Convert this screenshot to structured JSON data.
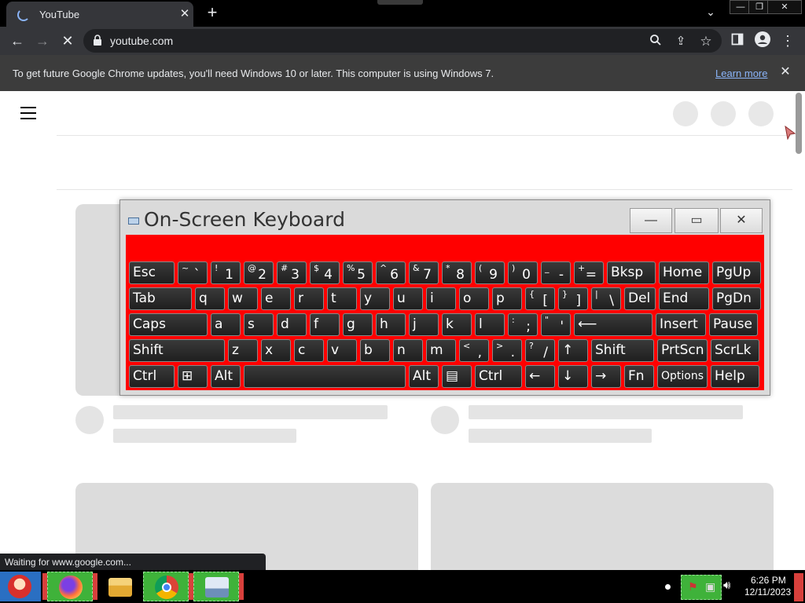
{
  "browser": {
    "tab_title": "YouTube",
    "tab_close_glyph": "✕",
    "new_tab_glyph": "+",
    "url": "youtube.com",
    "window_controls": {
      "minimize": "—",
      "maximize": "❐",
      "close": "✕"
    }
  },
  "infobar": {
    "message": "To get future Google Chrome updates, you'll need Windows 10 or later. This computer is using Windows 7.",
    "link": "Learn more",
    "close_glyph": "✕"
  },
  "osk": {
    "title": "On-Screen Keyboard",
    "controls": {
      "minimize": "—",
      "maximize": "▭",
      "close": "✕"
    },
    "accent_color": "#ff0000",
    "rows": [
      [
        {
          "label": "Esc"
        },
        {
          "top": "~",
          "bottom": "`"
        },
        {
          "top": "!",
          "bottom": "1"
        },
        {
          "top": "@",
          "bottom": "2"
        },
        {
          "top": "#",
          "bottom": "3"
        },
        {
          "top": "$",
          "bottom": "4"
        },
        {
          "top": "%",
          "bottom": "5"
        },
        {
          "top": "^",
          "bottom": "6"
        },
        {
          "top": "&",
          "bottom": "7"
        },
        {
          "top": "*",
          "bottom": "8"
        },
        {
          "top": "(",
          "bottom": "9"
        },
        {
          "top": ")",
          "bottom": "0"
        },
        {
          "top": "_",
          "bottom": "-"
        },
        {
          "top": "+",
          "bottom": "="
        },
        {
          "label": "Bksp"
        },
        {
          "label": "Home"
        },
        {
          "label": "PgUp"
        }
      ],
      [
        {
          "label": "Tab"
        },
        {
          "label": "q"
        },
        {
          "label": "w"
        },
        {
          "label": "e"
        },
        {
          "label": "r"
        },
        {
          "label": "t"
        },
        {
          "label": "y"
        },
        {
          "label": "u"
        },
        {
          "label": "i"
        },
        {
          "label": "o"
        },
        {
          "label": "p"
        },
        {
          "top": "{",
          "bottom": "["
        },
        {
          "top": "}",
          "bottom": "]"
        },
        {
          "top": "|",
          "bottom": "\\"
        },
        {
          "label": "Del"
        },
        {
          "label": "End"
        },
        {
          "label": "PgDn"
        }
      ],
      [
        {
          "label": "Caps"
        },
        {
          "label": "a"
        },
        {
          "label": "s"
        },
        {
          "label": "d"
        },
        {
          "label": "f"
        },
        {
          "label": "g"
        },
        {
          "label": "h"
        },
        {
          "label": "j"
        },
        {
          "label": "k"
        },
        {
          "label": "l"
        },
        {
          "top": ":",
          "bottom": ";"
        },
        {
          "top": "\"",
          "bottom": "'"
        },
        {
          "label": "⟵"
        },
        {
          "label": "Insert"
        },
        {
          "label": "Pause"
        }
      ],
      [
        {
          "label": "Shift"
        },
        {
          "label": "z"
        },
        {
          "label": "x"
        },
        {
          "label": "c"
        },
        {
          "label": "v"
        },
        {
          "label": "b"
        },
        {
          "label": "n"
        },
        {
          "label": "m"
        },
        {
          "top": "<",
          "bottom": ","
        },
        {
          "top": ">",
          "bottom": "."
        },
        {
          "top": "?",
          "bottom": "/"
        },
        {
          "label": "↑"
        },
        {
          "label": "Shift"
        },
        {
          "label": "PrtScn"
        },
        {
          "label": "ScrLk"
        }
      ],
      [
        {
          "label": "Ctrl"
        },
        {
          "label": "⊞"
        },
        {
          "label": "Alt"
        },
        {
          "label": ""
        },
        {
          "label": "Alt"
        },
        {
          "label": "▤"
        },
        {
          "label": "Ctrl"
        },
        {
          "label": "←"
        },
        {
          "label": "↓"
        },
        {
          "label": "→"
        },
        {
          "label": "Fn"
        },
        {
          "label": "Options"
        },
        {
          "label": "Help"
        }
      ]
    ]
  },
  "status_bubble": "Waiting for www.google.com...",
  "taskbar": {
    "time": "6:26 PM",
    "date": "12/11/2023",
    "apps": [
      "santa-app",
      "firefox",
      "file-explorer",
      "chrome",
      "on-screen-keyboard"
    ],
    "highlight_color": "#3fb23a"
  }
}
